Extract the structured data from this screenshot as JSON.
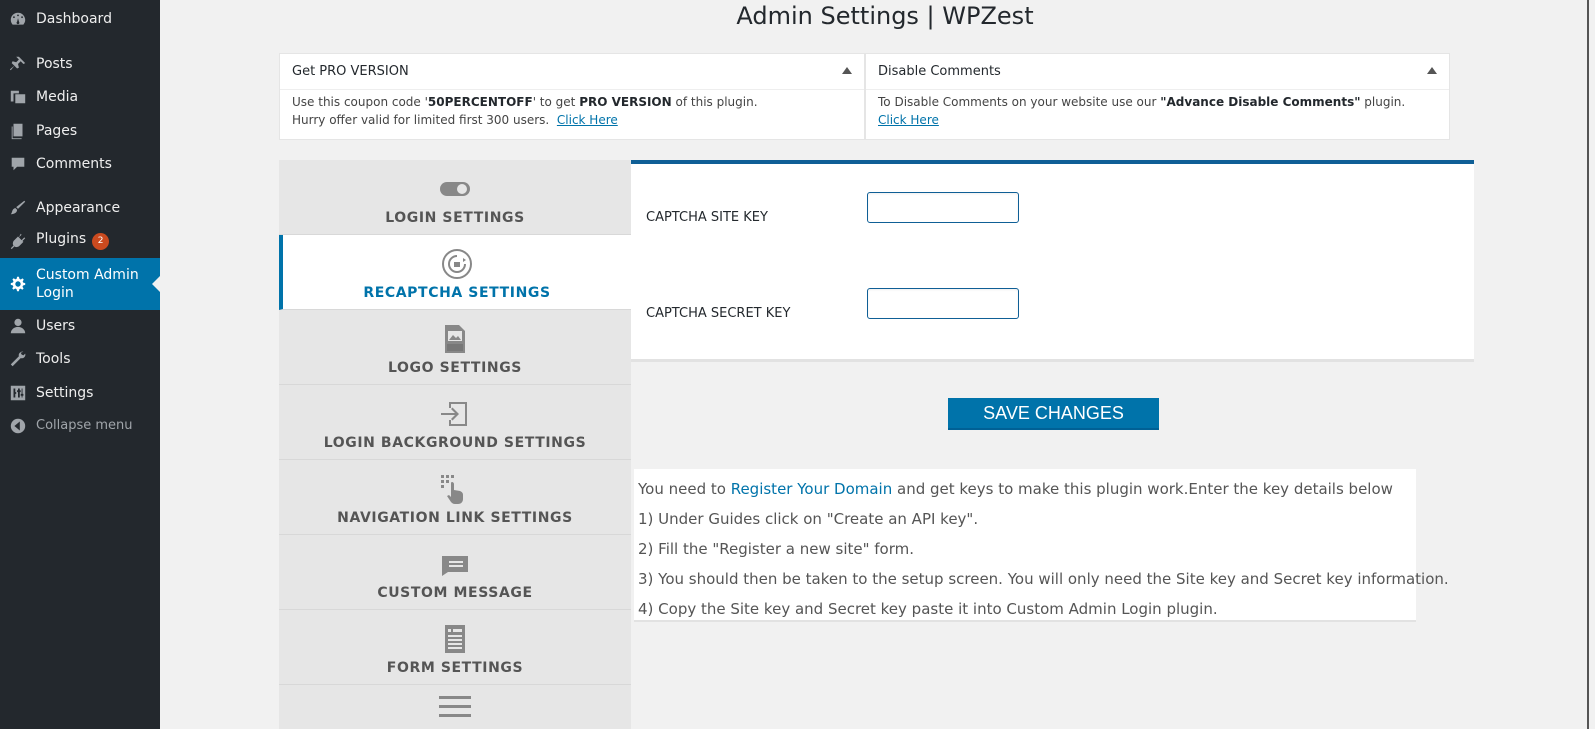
{
  "sidebar": {
    "items": [
      {
        "label": "Dashboard",
        "icon": "dashboard-icon"
      },
      {
        "label": "Posts",
        "icon": "pin-icon"
      },
      {
        "label": "Media",
        "icon": "media-icon"
      },
      {
        "label": "Pages",
        "icon": "pages-icon"
      },
      {
        "label": "Comments",
        "icon": "comments-icon"
      },
      {
        "label": "Appearance",
        "icon": "brush-icon"
      },
      {
        "label": "Plugins",
        "icon": "plugin-icon",
        "badge": "2"
      },
      {
        "label": "Custom Admin Login",
        "icon": "gear-icon",
        "active": true
      },
      {
        "label": "Users",
        "icon": "user-icon"
      },
      {
        "label": "Tools",
        "icon": "wrench-icon"
      },
      {
        "label": "Settings",
        "icon": "sliders-icon"
      },
      {
        "label": "Collapse menu",
        "icon": "collapse-icon"
      }
    ]
  },
  "page": {
    "title": "Admin Settings | WPZest"
  },
  "notices": {
    "pro": {
      "title": "Get PRO VERSION",
      "text_1": "Use this coupon code '",
      "code": "50PERCENTOFF",
      "text_2": "' to get ",
      "pro_version": "PRO VERSION",
      "text_3": " of this plugin.",
      "text_4": "Hurry offer valid for limited first 300 users.",
      "link": "Click Here"
    },
    "comments": {
      "title": "Disable Comments",
      "text_1": "To Disable Comments on your website use our ",
      "plugin_name": "\"Advance Disable Comments\"",
      "text_2": " plugin.",
      "link": "Click Here"
    }
  },
  "tabs": [
    {
      "label": "LOGIN SETTINGS",
      "icon": "toggle-icon"
    },
    {
      "label": "RECAPTCHA SETTINGS",
      "icon": "recaptcha-icon",
      "active": true
    },
    {
      "label": "LOGO SETTINGS",
      "icon": "image-file-icon"
    },
    {
      "label": "LOGIN BACKGROUND SETTINGS",
      "icon": "login-arrow-icon"
    },
    {
      "label": "NAVIGATION LINK SETTINGS",
      "icon": "pointer-icon"
    },
    {
      "label": "CUSTOM MESSAGE",
      "icon": "message-icon"
    },
    {
      "label": "FORM SETTINGS",
      "icon": "form-icon"
    },
    {
      "label": "",
      "icon": "menu-lines-icon"
    }
  ],
  "form": {
    "site_key_label": "CAPTCHA SITE KEY",
    "site_key_value": "",
    "secret_key_label": "CAPTCHA SECRET KEY",
    "secret_key_value": "",
    "save_label": "SAVE CHANGES"
  },
  "info": {
    "line1_a": "You need to ",
    "line1_link": "Register Your Domain",
    "line1_b": " and get keys to make this plugin work.Enter the key details below",
    "step1": "1) Under Guides click on \"Create an API key\".",
    "step2": "2) Fill the \"Register a new site\" form.",
    "step3": "3) You should then be taken to the setup screen. You will only need the Site key and Secret key information.",
    "step4": "4) Copy the Site key and Secret key paste it into Custom Admin Login plugin."
  },
  "colors": {
    "accent": "#0073aa",
    "sidebar_bg": "#23282d",
    "badge": "#ca4a1f"
  }
}
